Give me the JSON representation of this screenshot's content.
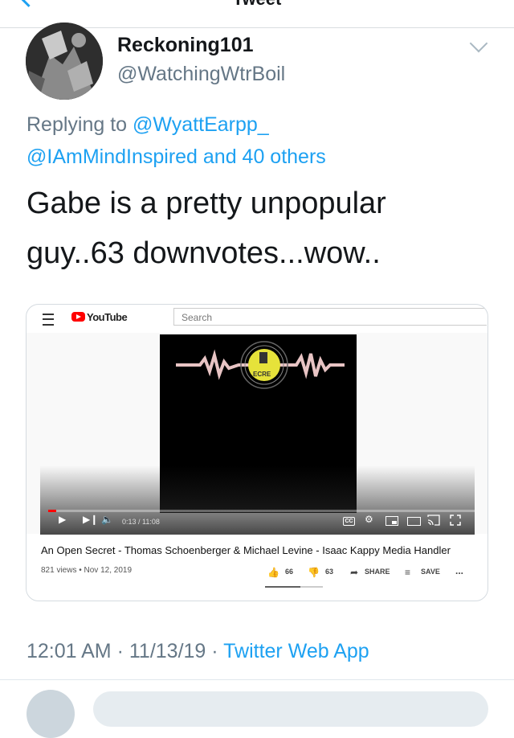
{
  "nav": {
    "title": "Tweet"
  },
  "tweet": {
    "display_name": "Reckoning101",
    "handle": "@WatchingWtrBoil",
    "replying_prefix": "Replying to",
    "replying_to_1": "@WyattEarpp_",
    "replying_to_2": "@IAmMindInspired and 40 others",
    "text_line1": "Gabe is a pretty unpopular",
    "text_line2": "guy..63 downvotes...wow..",
    "time": "12:01 AM",
    "date": "11/13/19",
    "sep": "·",
    "source": "Twitter Web App"
  },
  "youtube": {
    "logo_text": "YouTube",
    "search_placeholder": "Search",
    "time_display": "0:13 / 11:08",
    "progress": 0.0195,
    "cc_label": "CC",
    "video_title": "An Open Secret - Thomas Schoenberger & Michael Levine - Isaac Kappy Media Handler",
    "views_date": "821 views • Nov 12, 2019",
    "likes": "66",
    "dislikes": "63",
    "share_label": "SHARE",
    "save_label": "SAVE",
    "more_label": "...",
    "logo_fragment": "ECRE"
  },
  "icons": {
    "back": "chevron-left-icon",
    "caret": "chevron-down-icon",
    "menu": "hamburger-icon",
    "play": "play-icon",
    "next": "next-icon",
    "volume": "volume-icon",
    "settings": "gear-icon",
    "miniplayer": "miniplayer-icon",
    "theater": "theater-icon",
    "cast": "cast-icon",
    "fullscreen": "fullscreen-icon",
    "like": "thumbs-up-icon",
    "dislike": "thumbs-down-icon",
    "share": "share-icon",
    "save": "save-playlist-icon"
  },
  "colors": {
    "link": "#1da1f2",
    "secondary": "#657786",
    "youtube_red": "#ff0000"
  }
}
